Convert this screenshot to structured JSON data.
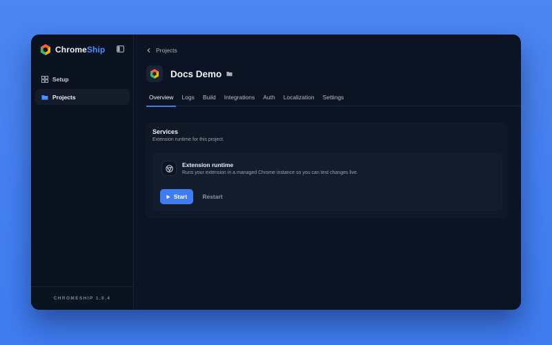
{
  "app": {
    "brand_primary": "Chrome",
    "brand_accent": "Ship",
    "version": "CHROMESHIP 1.0.4"
  },
  "colors": {
    "accent": "#3f7cf0",
    "background": "#0c1322",
    "desktop": "#4b86f2"
  },
  "sidebar": {
    "items": [
      {
        "label": "Setup",
        "icon": "grid-icon",
        "active": false
      },
      {
        "label": "Projects",
        "icon": "folder-icon",
        "active": true
      }
    ]
  },
  "breadcrumb": {
    "label": "Projects"
  },
  "project": {
    "title": "Docs Demo"
  },
  "tabs": [
    {
      "label": "Overview",
      "active": true
    },
    {
      "label": "Logs",
      "active": false
    },
    {
      "label": "Build",
      "active": false
    },
    {
      "label": "Integrations",
      "active": false
    },
    {
      "label": "Auth",
      "active": false
    },
    {
      "label": "Localization",
      "active": false
    },
    {
      "label": "Settings",
      "active": false
    }
  ],
  "services": {
    "title": "Services",
    "subtitle": "Extension runtime for this project.",
    "runtime": {
      "name": "Extension runtime",
      "description": "Runs your extension in a managed Chrome instance so you can test changes live.",
      "icon": "chrome-icon",
      "start_label": "Start",
      "restart_label": "Restart"
    }
  }
}
